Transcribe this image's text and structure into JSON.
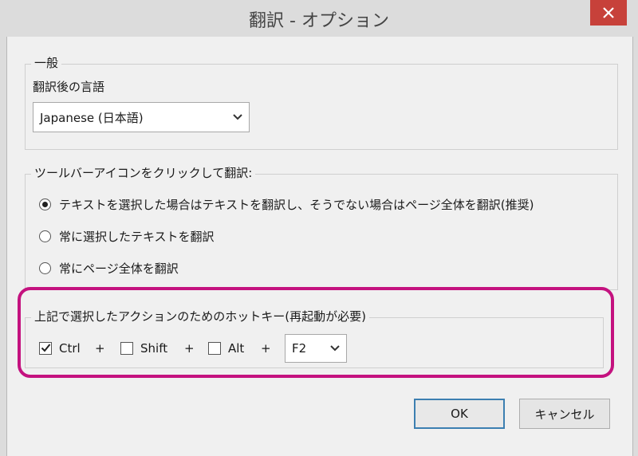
{
  "window": {
    "title": "翻訳 - オプション"
  },
  "general": {
    "legend": "一般",
    "language_label": "翻訳後の言語",
    "language_value": "Japanese (日本語)"
  },
  "toolbar_action": {
    "legend": "ツールバーアイコンをクリックして翻訳:",
    "options": [
      {
        "label": "テキストを選択した場合はテキストを翻訳し、そうでない場合はページ全体を翻訳(推奨)",
        "selected": true
      },
      {
        "label": "常に選択したテキストを翻訳",
        "selected": false
      },
      {
        "label": "常にページ全体を翻訳",
        "selected": false
      }
    ]
  },
  "hotkey": {
    "legend": "上記で選択したアクションのためのホットキー(再起動が必要)",
    "ctrl_label": "Ctrl",
    "ctrl_checked": true,
    "shift_label": "Shift",
    "shift_checked": false,
    "alt_label": "Alt",
    "alt_checked": false,
    "plus": "+",
    "key_value": "F2"
  },
  "buttons": {
    "ok": "OK",
    "cancel": "キャンセル"
  },
  "colors": {
    "highlight": "#c4127f",
    "close": "#c7413a",
    "default_button_border": "#3c7fb1"
  }
}
